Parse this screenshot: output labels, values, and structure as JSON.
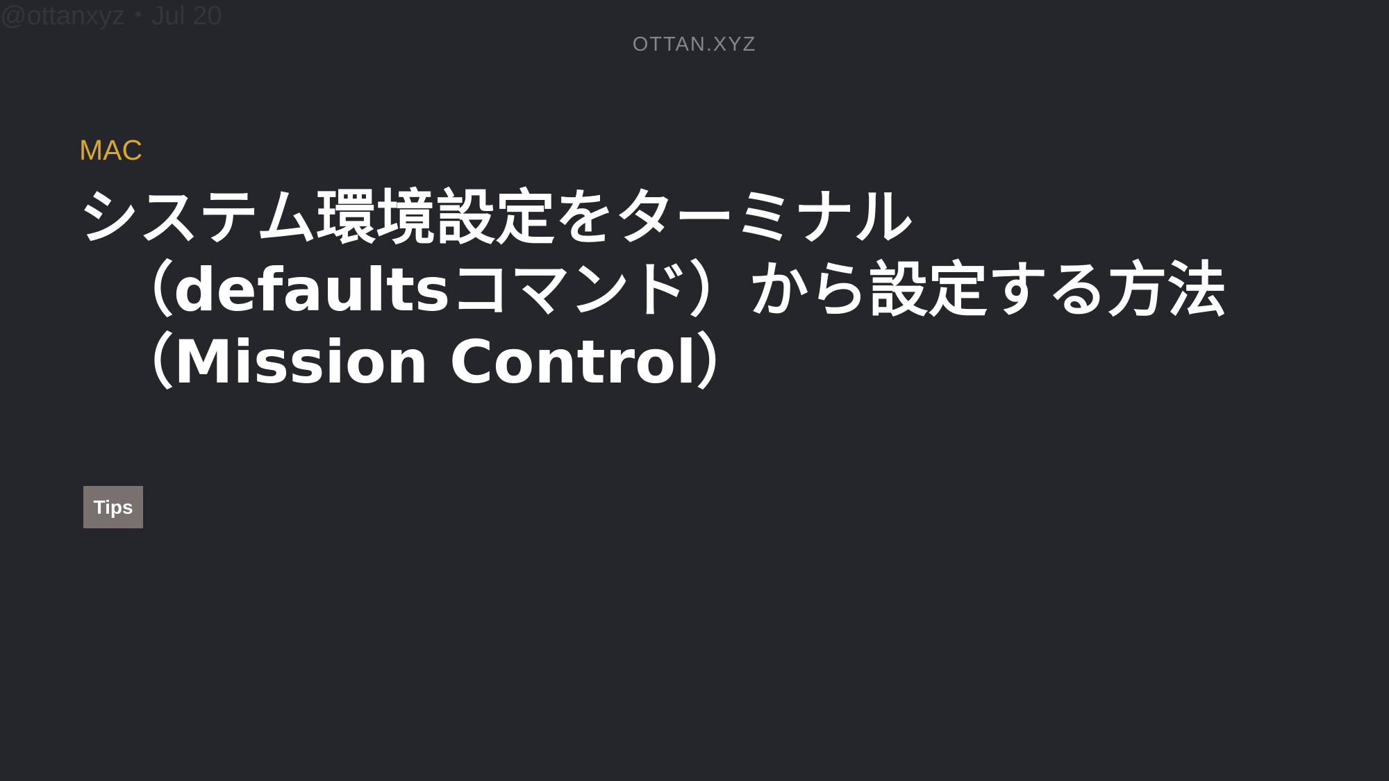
{
  "watermark": "@ottanxyz・Jul 20",
  "site": {
    "name": "OTTAN.XYZ"
  },
  "post": {
    "category": "MAC",
    "title_lines": [
      "システム環境設定をターミナル",
      "（defaultsコマンド）から設定する方法",
      "（Mission Control）"
    ],
    "tags": [
      "Tips"
    ]
  },
  "colors": {
    "background": "#25262b",
    "category_accent": "#d9a92f",
    "title": "#ffffff",
    "tag_background": "#78716f",
    "site_name": "#85868b"
  }
}
